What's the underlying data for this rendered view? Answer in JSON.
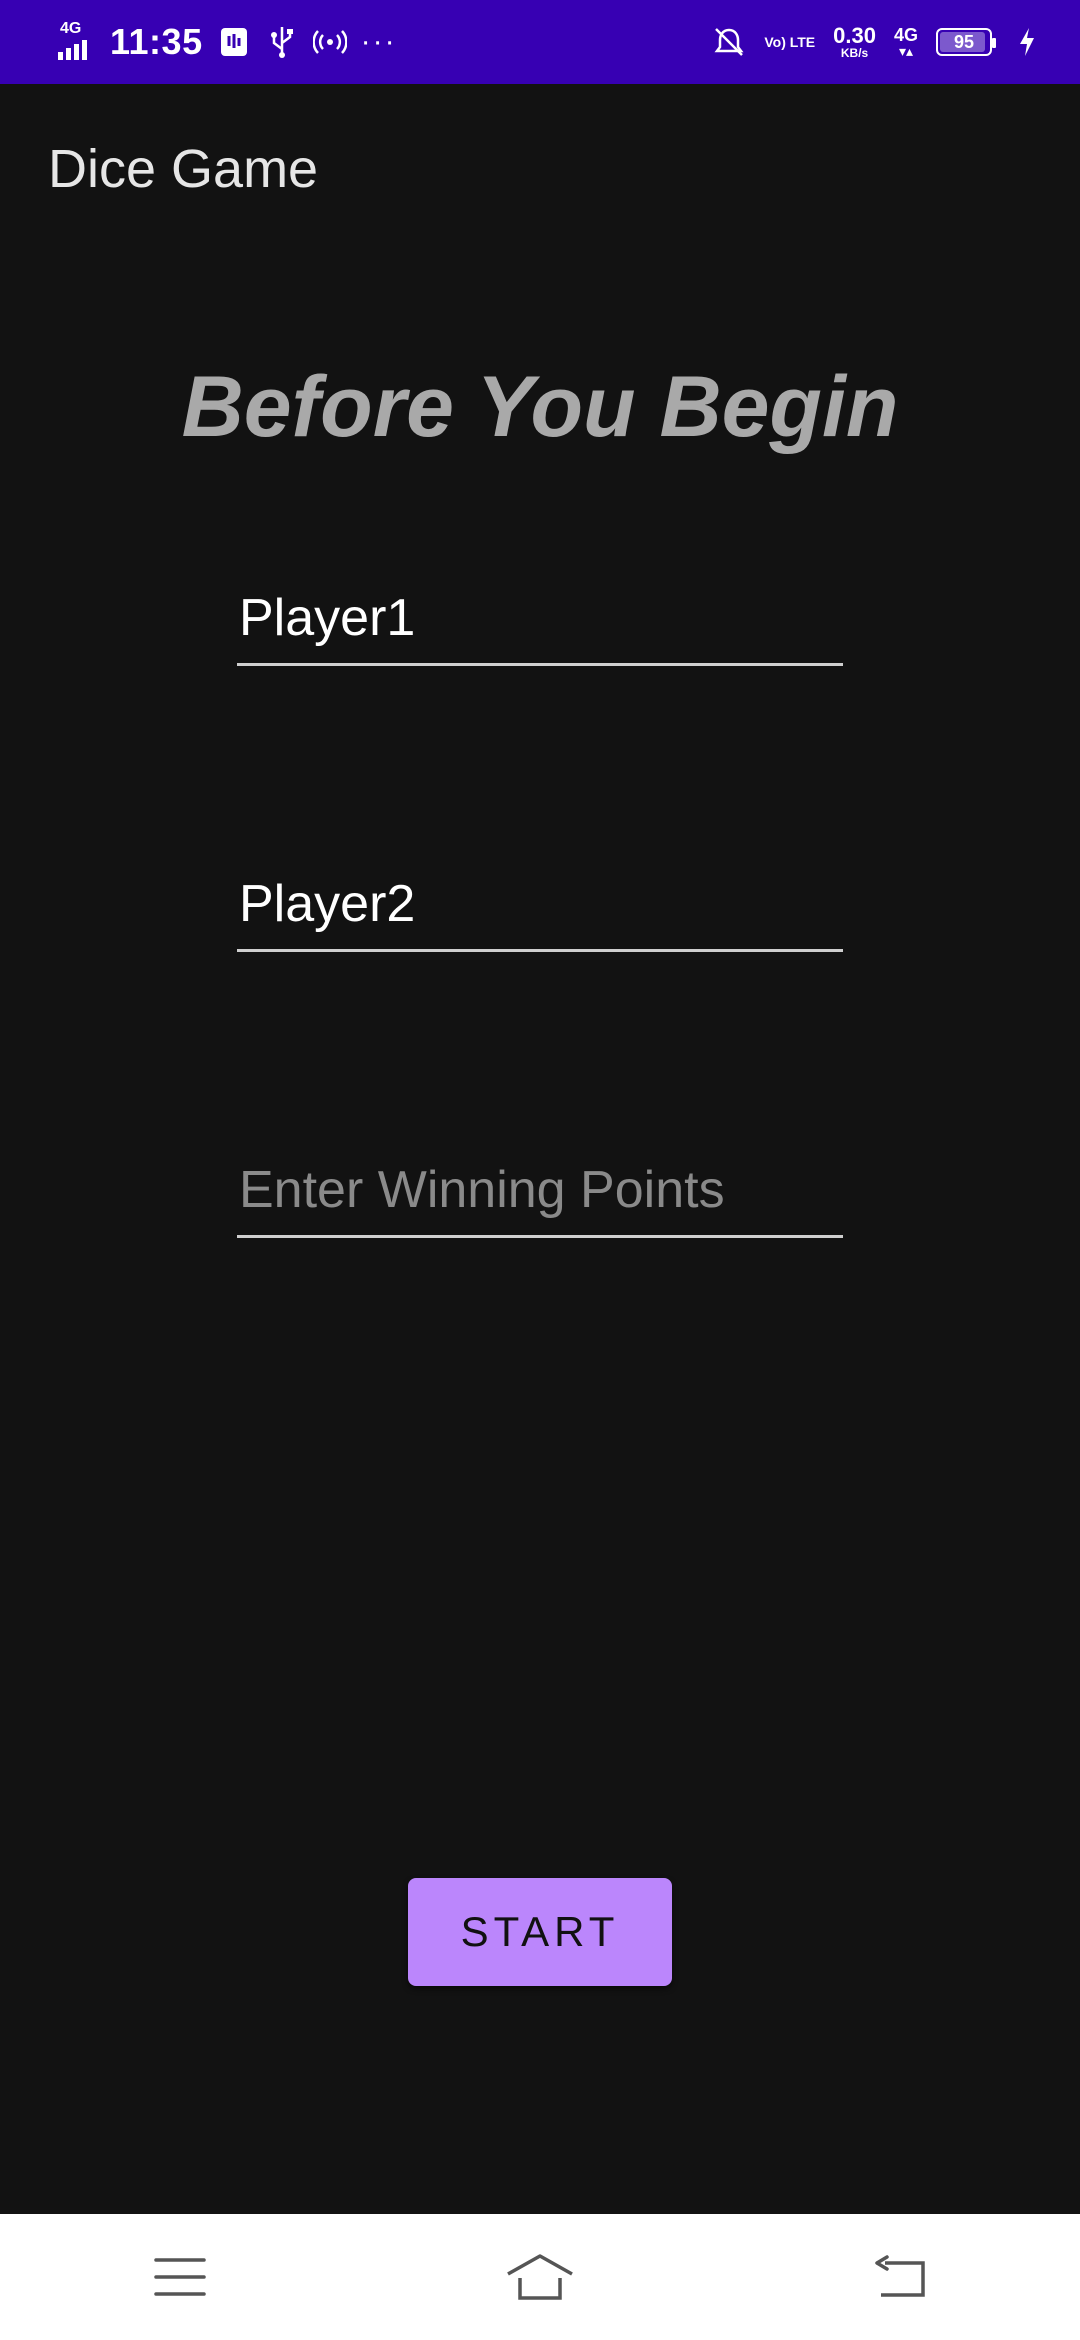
{
  "status_bar": {
    "network_tag": "4G",
    "time": "11:35",
    "dots": "···",
    "volte": "Vo) LTE",
    "speed_value": "0.30",
    "speed_unit": "KB/s",
    "network_tag_right": "4G",
    "battery_level": "95"
  },
  "app_bar": {
    "title": "Dice Game"
  },
  "main": {
    "heading": "Before You Begin",
    "player1": {
      "value": "Player1",
      "placeholder": ""
    },
    "player2": {
      "value": "Player2",
      "placeholder": ""
    },
    "winning_points": {
      "value": "",
      "placeholder": "Enter Winning Points"
    },
    "start_label": "START"
  },
  "colors": {
    "status_bar": "#3700b3",
    "background": "#121212",
    "button": "#bb86fc",
    "heading": "#a9a9a9"
  },
  "icons": {
    "status_left": [
      "signal-4g-icon",
      "sim-card-icon",
      "usb-icon",
      "hotspot-icon",
      "more-dots-icon"
    ],
    "status_right": [
      "alarm-off-icon",
      "volte-icon",
      "data-speed-icon",
      "signal-4g-icon",
      "battery-icon",
      "charging-icon"
    ],
    "nav": [
      "menu-icon",
      "home-icon",
      "back-icon"
    ]
  }
}
